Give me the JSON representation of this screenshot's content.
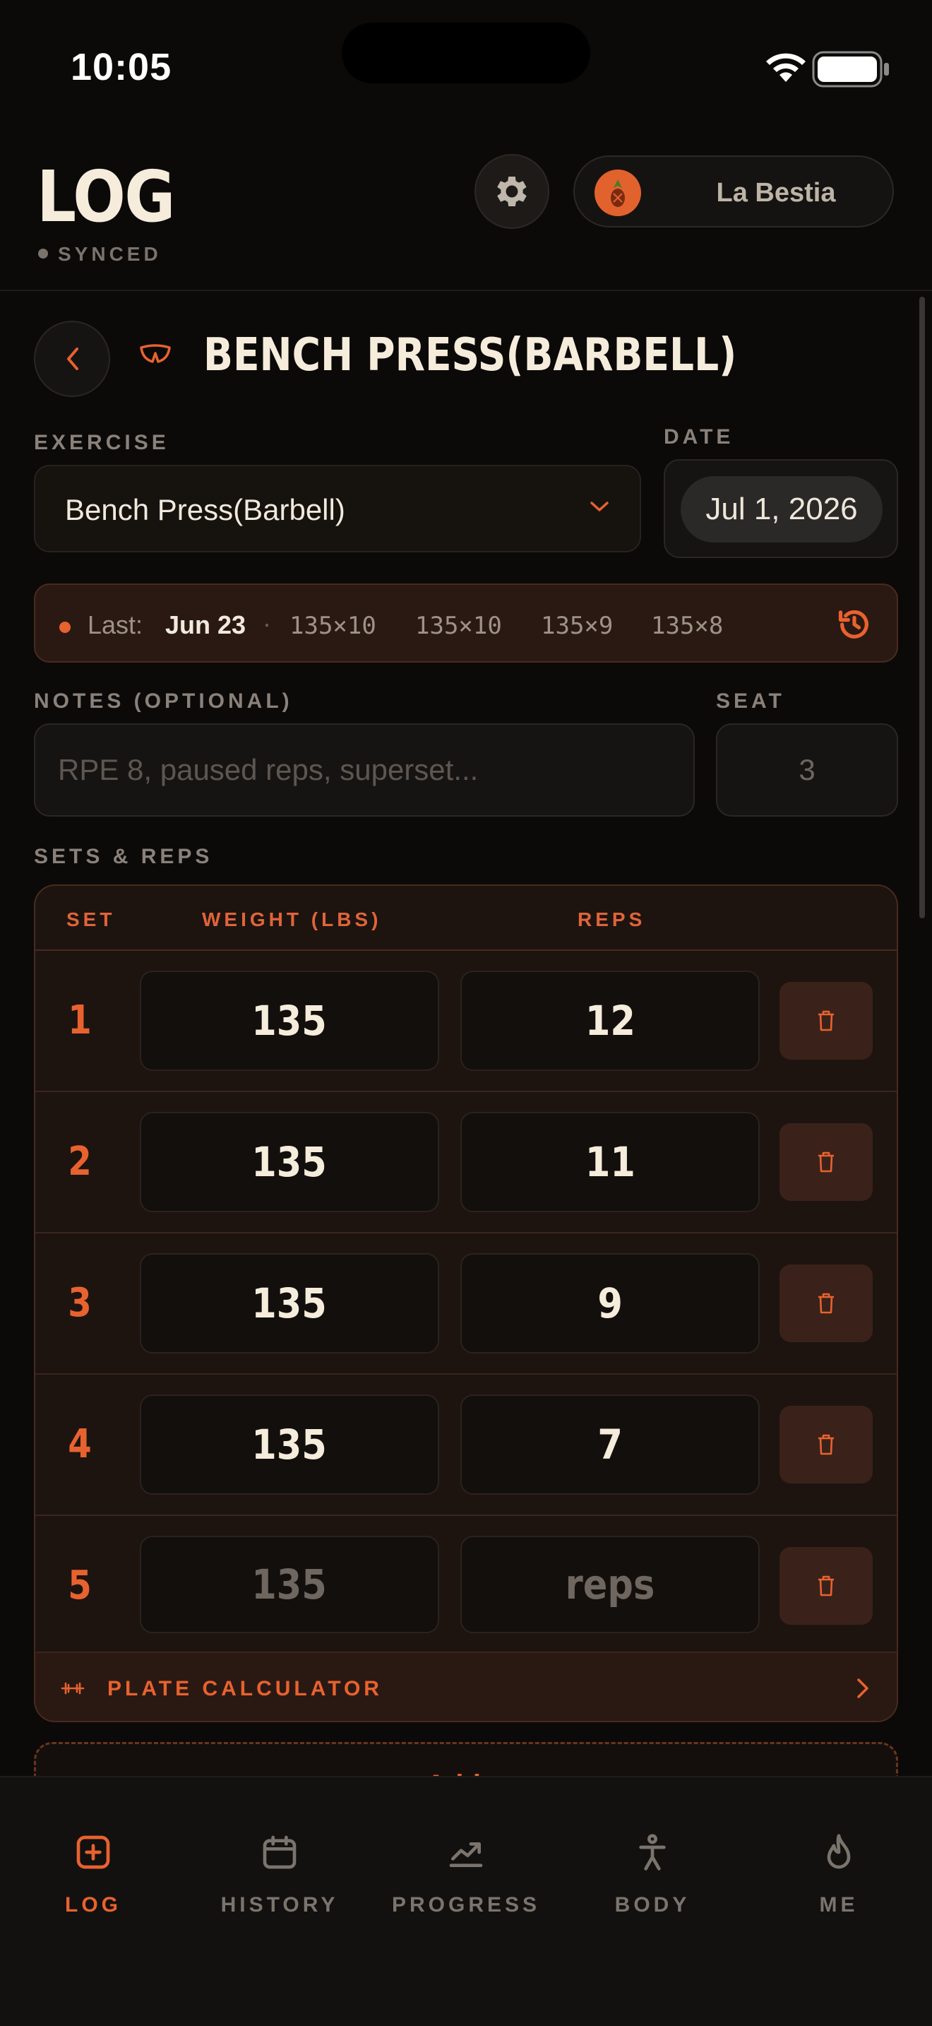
{
  "status": {
    "time": "10:05"
  },
  "header": {
    "title": "LOG",
    "sync_status": "SYNCED",
    "profile_name": "La Bestia"
  },
  "exercise": {
    "title": "BENCH PRESS(BARBELL)",
    "exercise_label": "EXERCISE",
    "exercise_value": "Bench Press(Barbell)",
    "date_label": "DATE",
    "date_value": "Jul 1, 2026"
  },
  "last_session": {
    "label": "Last:",
    "date": "Jun 23",
    "separator": "·",
    "sets": [
      "135×10",
      "135×10",
      "135×9",
      "135×8"
    ]
  },
  "notes": {
    "label": "NOTES (OPTIONAL)",
    "placeholder": "RPE 8, paused reps, superset...",
    "seat_label": "SEAT",
    "seat_value": "3"
  },
  "sets": {
    "section_label": "SETS & REPS",
    "col_set": "SET",
    "col_weight": "WEIGHT (LBS)",
    "col_reps": "REPS",
    "rows": [
      {
        "num": "1",
        "weight": "135",
        "reps": "12"
      },
      {
        "num": "2",
        "weight": "135",
        "reps": "11"
      },
      {
        "num": "3",
        "weight": "135",
        "reps": "9"
      },
      {
        "num": "4",
        "weight": "135",
        "reps": "7"
      },
      {
        "num": "5",
        "weight": "135",
        "reps": "reps"
      }
    ],
    "plate_calculator_label": "PLATE CALCULATOR",
    "add_set_label": "+ Add set"
  },
  "tabs": [
    {
      "label": "LOG",
      "icon": "plus-square-icon",
      "active": true
    },
    {
      "label": "HISTORY",
      "icon": "calendar-icon",
      "active": false
    },
    {
      "label": "PROGRESS",
      "icon": "trend-up-icon",
      "active": false
    },
    {
      "label": "BODY",
      "icon": "body-figure-icon",
      "active": false
    },
    {
      "label": "ME",
      "icon": "flame-icon",
      "active": false
    }
  ],
  "colors": {
    "accent": "#e8622f",
    "background": "#0b0a09",
    "card": "#1d1410"
  }
}
